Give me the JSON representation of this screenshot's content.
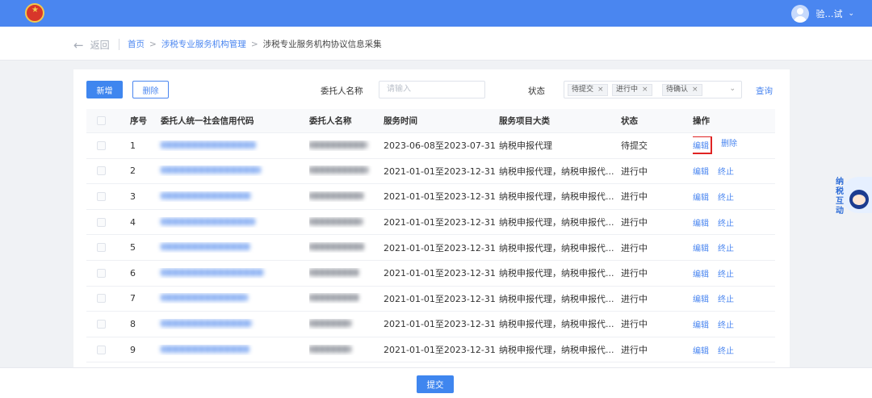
{
  "header": {
    "username": "验…试",
    "user_chevron": "⌄"
  },
  "subheader": {
    "back_label": "返回",
    "breadcrumbs": [
      "首页",
      "涉税专业服务机构管理",
      "涉税专业服务机构协议信息采集"
    ],
    "separator": ">"
  },
  "toolbar": {
    "new_label": "新增",
    "delete_label": "删除",
    "name_label": "委托人名称",
    "name_placeholder": "请输入",
    "status_label": "状态",
    "status_tags": [
      "待提交",
      "进行中",
      "待确认"
    ],
    "tag_close": "×",
    "query_label": "查询"
  },
  "table": {
    "headers": [
      "序号",
      "委托人统一社会信用代码",
      "委托人名称",
      "服务时间",
      "服务项目大类",
      "状态",
      "操作"
    ],
    "rows": [
      {
        "index": "1",
        "service_time": "2023-06-08至2023-07-31",
        "category": "纳税申报代理",
        "status": "待提交",
        "actions": [
          "编辑",
          "删除"
        ]
      },
      {
        "index": "2",
        "service_time": "2021-01-01至2023-12-31",
        "category": "纳税申报代理，纳税申报代...",
        "status": "进行中",
        "actions": [
          "编辑",
          "终止"
        ]
      },
      {
        "index": "3",
        "service_time": "2021-01-01至2023-12-31",
        "category": "纳税申报代理，纳税申报代...",
        "status": "进行中",
        "actions": [
          "编辑",
          "终止"
        ]
      },
      {
        "index": "4",
        "service_time": "2021-01-01至2023-12-31",
        "category": "纳税申报代理，纳税申报代...",
        "status": "进行中",
        "actions": [
          "编辑",
          "终止"
        ]
      },
      {
        "index": "5",
        "service_time": "2021-01-01至2023-12-31",
        "category": "纳税申报代理，纳税申报代...",
        "status": "进行中",
        "actions": [
          "编辑",
          "终止"
        ]
      },
      {
        "index": "6",
        "service_time": "2021-01-01至2023-12-31",
        "category": "纳税申报代理，纳税申报代...",
        "status": "进行中",
        "actions": [
          "编辑",
          "终止"
        ]
      },
      {
        "index": "7",
        "service_time": "2021-01-01至2023-12-31",
        "category": "纳税申报代理，纳税申报代...",
        "status": "进行中",
        "actions": [
          "编辑",
          "终止"
        ]
      },
      {
        "index": "8",
        "service_time": "2021-01-01至2023-12-31",
        "category": "纳税申报代理，纳税申报代...",
        "status": "进行中",
        "actions": [
          "编辑",
          "终止"
        ]
      },
      {
        "index": "9",
        "service_time": "2021-01-01至2023-12-31",
        "category": "纳税申报代理，纳税申报代...",
        "status": "进行中",
        "actions": [
          "编辑",
          "终止"
        ]
      }
    ]
  },
  "footer": {
    "submit_label": "提交"
  },
  "assistant": {
    "label": "纳税互动"
  },
  "colors": {
    "primary": "#4a86f0",
    "highlight": "#e02424",
    "header_bg": "#4a86f0"
  }
}
